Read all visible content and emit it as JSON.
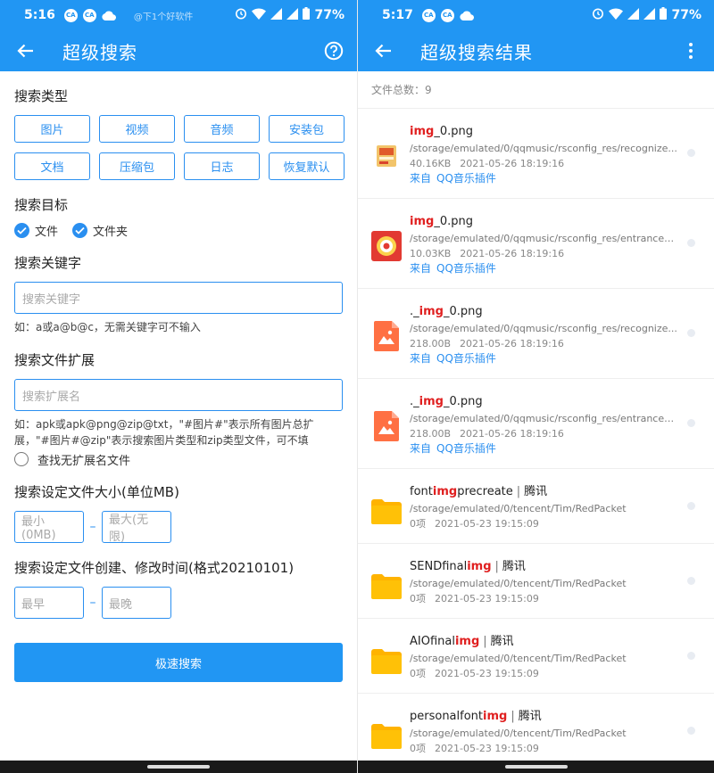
{
  "left": {
    "status": {
      "time": "5:16",
      "icon_a": "CA",
      "icon_b": "CA",
      "watermark": "@下1个好软件",
      "battery": "77%"
    },
    "appbar": {
      "title": "超级搜索",
      "back_icon": "arrow-back-icon",
      "help_icon": "help-circle-icon"
    },
    "search_type": {
      "label": "搜索类型",
      "buttons": [
        "图片",
        "视频",
        "音频",
        "安装包",
        "文档",
        "压缩包",
        "日志",
        "恢复默认"
      ]
    },
    "search_target": {
      "label": "搜索目标",
      "options": [
        "文件",
        "文件夹"
      ]
    },
    "keyword": {
      "label": "搜索关键字",
      "placeholder": "搜索关键字",
      "hint": "如：a或a@b@c，无需关键字可不输入"
    },
    "extension": {
      "label": "搜索文件扩展",
      "placeholder": "搜索扩展名",
      "hint": "如：apk或apk@png@zip@txt，\"#图片#\"表示所有图片总扩展，\"#图片#@zip\"表示搜索图片类型和zip类型文件，可不填",
      "no_ext_label": "查找无扩展名文件"
    },
    "size": {
      "label": "搜索设定文件大小(单位MB)",
      "min_placeholder": "最小(0MB)",
      "max_placeholder": "最大(无限)",
      "separator": "–"
    },
    "time": {
      "label": "搜索设定文件创建、修改时间(格式20210101)",
      "from_placeholder": "最早",
      "to_placeholder": "最晚",
      "separator": "–"
    },
    "submit_label": "极速搜索"
  },
  "right": {
    "status": {
      "time": "5:17",
      "icon_a": "CA",
      "icon_b": "CA",
      "battery": "77%"
    },
    "appbar": {
      "title": "超级搜索结果",
      "back_icon": "arrow-back-icon",
      "more_icon": "more-vert-icon"
    },
    "count_label": "文件总数：9",
    "items": [
      {
        "pre": "",
        "hl": "img",
        "post": "_0.png",
        "tag": "",
        "path": "/storage/emulated/0/qqmusic/rsconfig_res/recognize...",
        "size": "40.16KB",
        "date": "2021-05-26 18:19:16",
        "src_prefix": "来自",
        "src_name": "QQ音乐插件",
        "icon": "qqmusic-recognize-thumb-icon"
      },
      {
        "pre": "",
        "hl": "img",
        "post": "_0.png",
        "tag": "",
        "path": "/storage/emulated/0/qqmusic/rsconfig_res/entrance_i...",
        "size": "10.03KB",
        "date": "2021-05-26 18:19:16",
        "src_prefix": "来自",
        "src_name": "QQ音乐插件",
        "icon": "qqmusic-entrance-thumb-icon"
      },
      {
        "pre": "._",
        "hl": "img",
        "post": "_0.png",
        "tag": "",
        "path": "/storage/emulated/0/qqmusic/rsconfig_res/recognize...",
        "size": "218.00B",
        "date": "2021-05-26 18:19:16",
        "src_prefix": "来自",
        "src_name": "QQ音乐插件",
        "icon": "image-file-icon"
      },
      {
        "pre": "._",
        "hl": "img",
        "post": "_0.png",
        "tag": "",
        "path": "/storage/emulated/0/qqmusic/rsconfig_res/entrance_i...",
        "size": "218.00B",
        "date": "2021-05-26 18:19:16",
        "src_prefix": "来自",
        "src_name": "QQ音乐插件",
        "icon": "image-file-icon"
      },
      {
        "pre": "font",
        "hl": "img",
        "post": "precreate",
        "tag": "腾讯",
        "path": "/storage/emulated/0/tencent/Tim/RedPacket",
        "size": "0项",
        "date": "2021-05-23 19:15:09",
        "icon": "folder-icon"
      },
      {
        "pre": "SENDfinal",
        "hl": "img",
        "post": "",
        "tag": "腾讯",
        "path": "/storage/emulated/0/tencent/Tim/RedPacket",
        "size": "0项",
        "date": "2021-05-23 19:15:09",
        "icon": "folder-icon"
      },
      {
        "pre": "AIOfinal",
        "hl": "img",
        "post": "",
        "tag": "腾讯",
        "path": "/storage/emulated/0/tencent/Tim/RedPacket",
        "size": "0项",
        "date": "2021-05-23 19:15:09",
        "icon": "folder-icon"
      },
      {
        "pre": "personalfont",
        "hl": "img",
        "post": "",
        "tag": "腾讯",
        "path": "/storage/emulated/0/tencent/Tim/RedPacket",
        "size": "0项",
        "date": "2021-05-23 19:15:09",
        "icon": "folder-icon"
      }
    ]
  },
  "colors": {
    "primary": "#2196f3",
    "highlight": "#e02020",
    "folder": "#ffb300",
    "image_file": "#ff7043"
  }
}
